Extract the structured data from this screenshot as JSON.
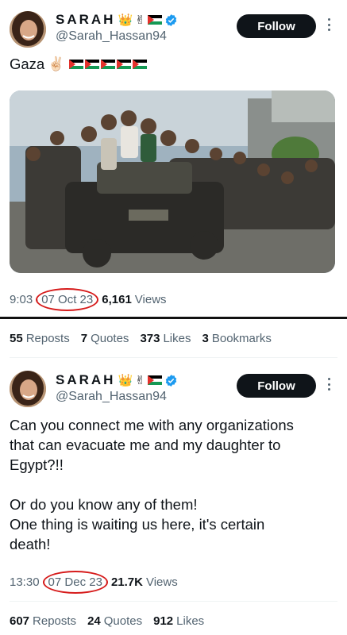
{
  "post1": {
    "display_name": "SARAH",
    "name_emojis": [
      "👑",
      "✌"
    ],
    "handle": "@Sarah_Hassan94",
    "follow_label": "Follow",
    "text": "Gaza",
    "text_emoji": "✌🏻",
    "time": "9:03",
    "date": "07 Oct 23",
    "views_count": "6,161",
    "views_label": "Views",
    "stats": [
      {
        "count": "55",
        "label": "Reposts"
      },
      {
        "count": "7",
        "label": "Quotes"
      },
      {
        "count": "373",
        "label": "Likes"
      },
      {
        "count": "3",
        "label": "Bookmarks"
      }
    ]
  },
  "post2": {
    "display_name": "SARAH",
    "name_emojis": [
      "👑",
      "✌"
    ],
    "handle": "@Sarah_Hassan94",
    "follow_label": "Follow",
    "text_lines": [
      "Can you connect me with any organizations",
      "that can evacuate me and my daughter to",
      "Egypt?!!",
      "",
      "Or do you know any of them!",
      "One thing is waiting us here, it's certain",
      "death!"
    ],
    "time": "13:30",
    "date": "07 Dec 23",
    "views_count": "21.7K",
    "views_label": "Views",
    "stats": [
      {
        "count": "607",
        "label": "Reposts"
      },
      {
        "count": "24",
        "label": "Quotes"
      },
      {
        "count": "912",
        "label": "Likes"
      }
    ]
  },
  "colors": {
    "text": "#0f1419",
    "muted": "#536471",
    "follow_bg": "#0f1419",
    "verified": "#1d9bf0",
    "annotation_circle": "#d61b1b"
  },
  "icons": [
    "verified-badge-icon",
    "palestine-flag-icon",
    "more-options-icon"
  ]
}
